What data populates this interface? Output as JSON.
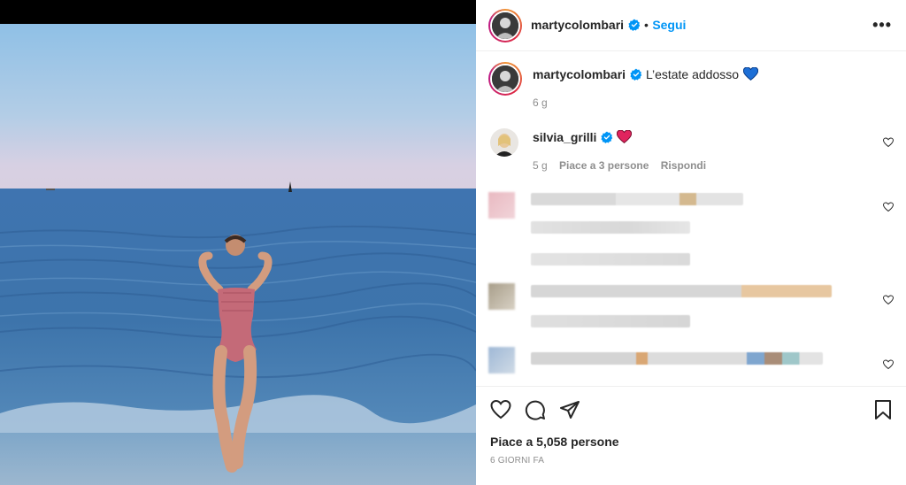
{
  "post": {
    "author": "martycolombari",
    "follow_label": "Segui",
    "dot": "•",
    "more_icon": "more-horizontal-icon",
    "verified_color": "#0095f6",
    "accent_color": "#0095f6"
  },
  "caption": {
    "author": "martycolombari",
    "text": "L’estate addosso",
    "emoji": "blue-heart",
    "time": "6 g"
  },
  "comments": [
    {
      "author": "silvia_grilli",
      "emoji": "red-heart",
      "time": "5 g",
      "likes": "Piace a 3 persone",
      "reply": "Rispondi"
    }
  ],
  "actions": {
    "like_icon": "heart-icon",
    "comment_icon": "comment-icon",
    "share_icon": "share-icon",
    "save_icon": "bookmark-icon"
  },
  "likes_text": "Piace a 5,058 persone",
  "date_text": "6 GIORNI FA"
}
